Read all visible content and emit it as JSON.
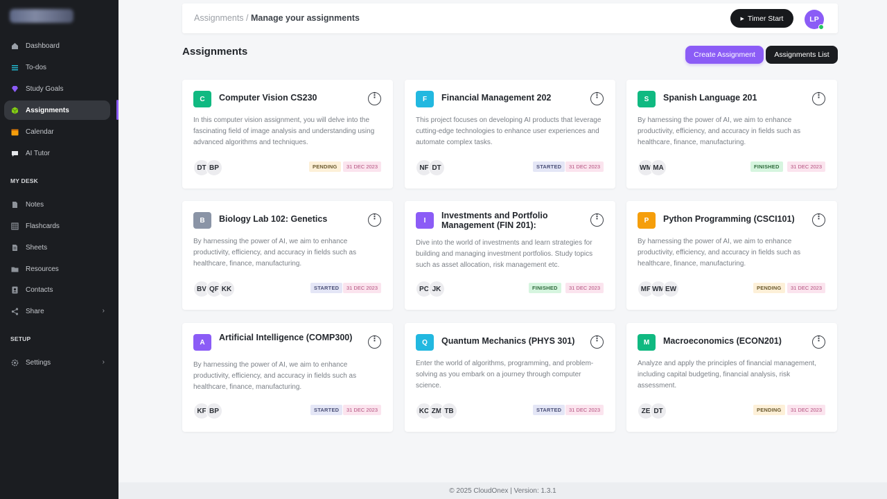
{
  "sidebar": {
    "items": [
      {
        "label": "Dashboard",
        "icon": "dashboard-icon",
        "color": "#9aa0a8"
      },
      {
        "label": "To-dos",
        "icon": "todo-list-icon",
        "color": "#22b8cf"
      },
      {
        "label": "Study Goals",
        "icon": "diamond-icon",
        "color": "#8b5cf6"
      },
      {
        "label": "Assignments",
        "icon": "cube-icon",
        "color": "#84cc16"
      },
      {
        "label": "Calendar",
        "icon": "calendar-icon",
        "color": "#f59e0b"
      },
      {
        "label": "AI Tutor",
        "icon": "chat-bubble-icon",
        "color": "#e5e7eb"
      }
    ],
    "my_desk_label": "MY DESK",
    "desk_items": [
      {
        "label": "Notes",
        "icon": "note-icon"
      },
      {
        "label": "Flashcards",
        "icon": "grid-icon"
      },
      {
        "label": "Sheets",
        "icon": "sheet-icon"
      },
      {
        "label": "Resources",
        "icon": "folder-icon"
      },
      {
        "label": "Contacts",
        "icon": "contact-icon"
      },
      {
        "label": "Share",
        "icon": "share-icon"
      }
    ],
    "setup_label": "SETUP",
    "settings_label": "Settings"
  },
  "header": {
    "breadcrumb_parent": "Assignments /",
    "breadcrumb_current": "Manage your assignments",
    "timer_label": "Timer Start",
    "user_initials": "LP"
  },
  "page": {
    "title": "Assignments",
    "create_label": "Create Assignment",
    "list_label": "Assignments List"
  },
  "cards": [
    {
      "letter": "C",
      "color": "#10b981",
      "title": "Computer Vision CS230",
      "desc": "In this computer vision assignment, you will delve into the fascinating field of image analysis and understanding using advanced algorithms and techniques.",
      "members": [
        "DT",
        "BP"
      ],
      "status": "PENDING",
      "date": "31 DEC 2023"
    },
    {
      "letter": "F",
      "color": "#22b8e0",
      "title": "Financial Management 202",
      "desc": "This project focuses on developing AI products that leverage cutting-edge technologies to enhance user experiences and automate complex tasks.",
      "members": [
        "NF",
        "DT"
      ],
      "status": "STARTED",
      "date": "31 DEC 2023"
    },
    {
      "letter": "S",
      "color": "#10b981",
      "title": "Spanish Language 201",
      "desc": "By harnessing the power of AI, we aim to enhance productivity, efficiency, and accuracy in fields such as healthcare, finance, manufacturing.",
      "members": [
        "WM",
        "MA"
      ],
      "status": "FINISHED",
      "date": "31 DEC 2023"
    },
    {
      "letter": "B",
      "color": "#8a94a6",
      "title": "Biology Lab 102: Genetics",
      "desc": "By harnessing the power of AI, we aim to enhance productivity, efficiency, and accuracy in fields such as healthcare, finance, manufacturing.",
      "members": [
        "BV",
        "QF",
        "KK"
      ],
      "status": "STARTED",
      "date": "31 DEC 2023"
    },
    {
      "letter": "I",
      "color": "#8b5cf6",
      "title": "Investments and Portfolio Management (FIN 201):",
      "desc": "Dive into the world of investments and learn strategies for building and managing investment portfolios. Study topics such as asset allocation, risk management etc.",
      "members": [
        "PC",
        "JK"
      ],
      "status": "FINISHED",
      "date": "31 DEC 2023"
    },
    {
      "letter": "P",
      "color": "#f59e0b",
      "title": "Python Programming (CSCI101)",
      "desc": "By harnessing the power of AI, we aim to enhance productivity, efficiency, and accuracy in fields such as healthcare, finance, manufacturing.",
      "members": [
        "MF",
        "WM",
        "EW"
      ],
      "status": "PENDING",
      "date": "31 DEC 2023"
    },
    {
      "letter": "A",
      "color": "#8b5cf6",
      "title": "Artificial Intelligence (COMP300)",
      "desc": "By harnessing the power of AI, we aim to enhance productivity, efficiency, and accuracy in fields such as healthcare, finance, manufacturing.",
      "members": [
        "KF",
        "BP"
      ],
      "status": "STARTED",
      "date": "31 DEC 2023"
    },
    {
      "letter": "Q",
      "color": "#22b8e0",
      "title": "Quantum Mechanics (PHYS 301)",
      "desc": "Enter the world of algorithms, programming, and problem-solving as you embark on a journey through computer science.",
      "members": [
        "KC",
        "ZM",
        "TB"
      ],
      "status": "STARTED",
      "date": "31 DEC 2023"
    },
    {
      "letter": "M",
      "color": "#10b981",
      "title": "Macroeconomics (ECON201)",
      "desc": "Analyze and apply the principles of financial management, including capital budgeting, financial analysis, risk assessment.",
      "members": [
        "ZE",
        "DT"
      ],
      "status": "PENDING",
      "date": "31 DEC 2023"
    }
  ],
  "footer": "© 2025 CloudOnex | Version: 1.3.1"
}
